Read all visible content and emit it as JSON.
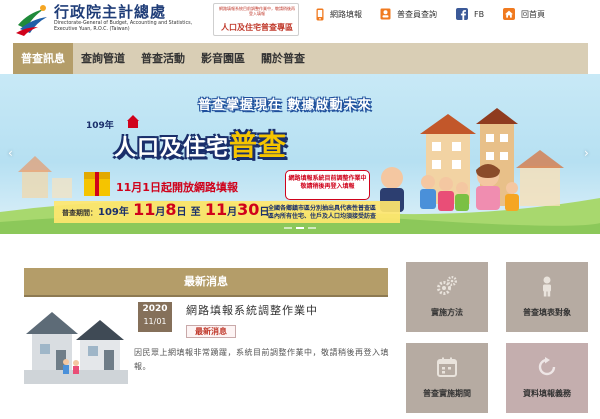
{
  "header": {
    "org_name": "行政院主計總處",
    "org_en_lines": [
      "Directorate-General of Budget, Accounting and Statistics,",
      "Executive Yuan, R.O.C. (Taiwan)"
    ],
    "census_badge_small": "網路填報系統目前調整作業中，敬請稍後再登入填報",
    "census_badge_label": "人口及住宅普查專區",
    "links": [
      {
        "label": "網路填報",
        "icon": "mobile-icon"
      },
      {
        "label": "普查員查詢",
        "icon": "id-card-icon"
      },
      {
        "label": "FB",
        "icon": "facebook-icon"
      },
      {
        "label": "回首頁",
        "icon": "home-icon"
      }
    ]
  },
  "nav": {
    "items": [
      {
        "label": "普查訊息",
        "active": true
      },
      {
        "label": "查詢管道",
        "active": false
      },
      {
        "label": "普查活動",
        "active": false
      },
      {
        "label": "影音園區",
        "active": false
      },
      {
        "label": "關於普查",
        "active": false
      }
    ]
  },
  "banner": {
    "slogan": "普查掌握現在 數據啟動未來",
    "roc_year": "109年",
    "title_main": "人口及住宅",
    "title_big": "普查",
    "launch": "11月1日起開放網路填報",
    "note_lines": [
      "網路填報系統目前調整作業中",
      "敬請稍後再登入填報"
    ],
    "period_label": "普查期間：",
    "period_prefix": "109年",
    "period_start_month": "11",
    "period_start_day": "8",
    "period_end_month": "11",
    "period_end_day": "30",
    "month_char": "月",
    "day_char": "日",
    "range_sep": "至",
    "period_notes": [
      "全國各鄉鎮市區分別抽出具代表性普查區",
      "區內所有住宅、住戶及人口均須接受訪查"
    ],
    "prev_label": "‹",
    "next_label": "›"
  },
  "news": {
    "header": "最新消息",
    "items": [
      {
        "year": "2020",
        "month_day": "11/01",
        "title": "網路填報系統調整作業中",
        "tag": "最新消息",
        "body": "因民眾上網填報非常踴躍，系統目前調整作業中，敬請稍後再登入填報。"
      }
    ]
  },
  "tiles": [
    {
      "label": "實施方法",
      "icon": "gears-icon"
    },
    {
      "label": "普查填表對象",
      "icon": "person-icon"
    },
    {
      "label": "普查實施期間",
      "icon": "calendar-icon"
    },
    {
      "label": "資料填報義務",
      "icon": "return-arrow-icon"
    }
  ],
  "colors": {
    "nav_bg": "#d9ceb5",
    "nav_active": "#b49d69",
    "news_header": "#b49d69",
    "date_box": "#85705a",
    "tile_bg": "#b6aba2",
    "brand_red": "#d0021b"
  }
}
